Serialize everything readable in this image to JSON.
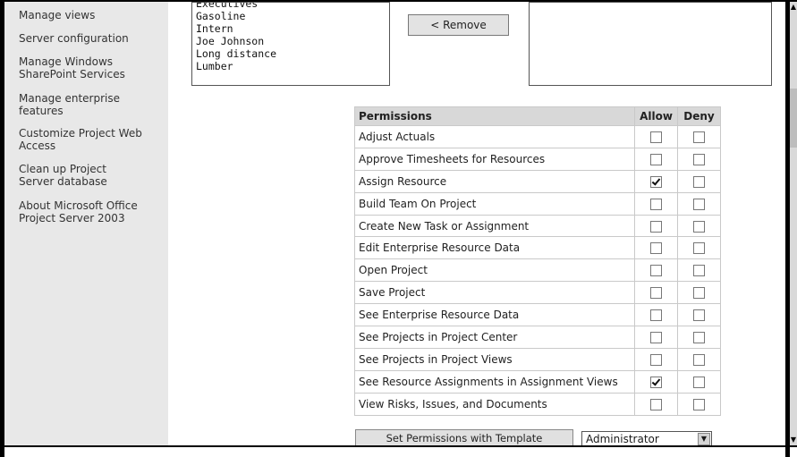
{
  "sidebar": {
    "items": [
      {
        "label": "Manage views"
      },
      {
        "label": "Server configuration"
      },
      {
        "label": "Manage Windows SharePoint Services"
      },
      {
        "label": "Manage enterprise features"
      },
      {
        "label": "Customize Project Web Access"
      },
      {
        "label": "Clean up Project Server database"
      },
      {
        "label": "About Microsoft Office Project Server 2003"
      }
    ]
  },
  "group_list": {
    "items": [
      "Executives",
      "Gasoline",
      "Intern",
      "Joe Johnson",
      "Long distance",
      "Lumber"
    ]
  },
  "remove_button": {
    "label": "< Remove"
  },
  "permissions": {
    "headers": {
      "name": "Permissions",
      "allow": "Allow",
      "deny": "Deny"
    },
    "rows": [
      {
        "name": "Adjust Actuals",
        "allow": false,
        "deny": false
      },
      {
        "name": "Approve Timesheets for Resources",
        "allow": false,
        "deny": false
      },
      {
        "name": "Assign Resource",
        "allow": true,
        "deny": false
      },
      {
        "name": "Build Team On Project",
        "allow": false,
        "deny": false
      },
      {
        "name": "Create New Task or Assignment",
        "allow": false,
        "deny": false
      },
      {
        "name": "Edit Enterprise Resource Data",
        "allow": false,
        "deny": false
      },
      {
        "name": "Open Project",
        "allow": false,
        "deny": false
      },
      {
        "name": "Save Project",
        "allow": false,
        "deny": false
      },
      {
        "name": "See Enterprise Resource Data",
        "allow": false,
        "deny": false
      },
      {
        "name": "See Projects in Project Center",
        "allow": false,
        "deny": false
      },
      {
        "name": "See Projects in Project Views",
        "allow": false,
        "deny": false
      },
      {
        "name": "See Resource Assignments in Assignment Views",
        "allow": true,
        "deny": false
      },
      {
        "name": "View Risks, Issues, and Documents",
        "allow": false,
        "deny": false
      }
    ]
  },
  "template_button": {
    "label": "Set Permissions with Template"
  },
  "template_select": {
    "value": "Administrator"
  },
  "icons": {
    "scroll_up": "scroll-up-arrow-icon",
    "scroll_down": "scroll-down-arrow-icon",
    "dropdown": "dropdown-arrow-icon"
  }
}
